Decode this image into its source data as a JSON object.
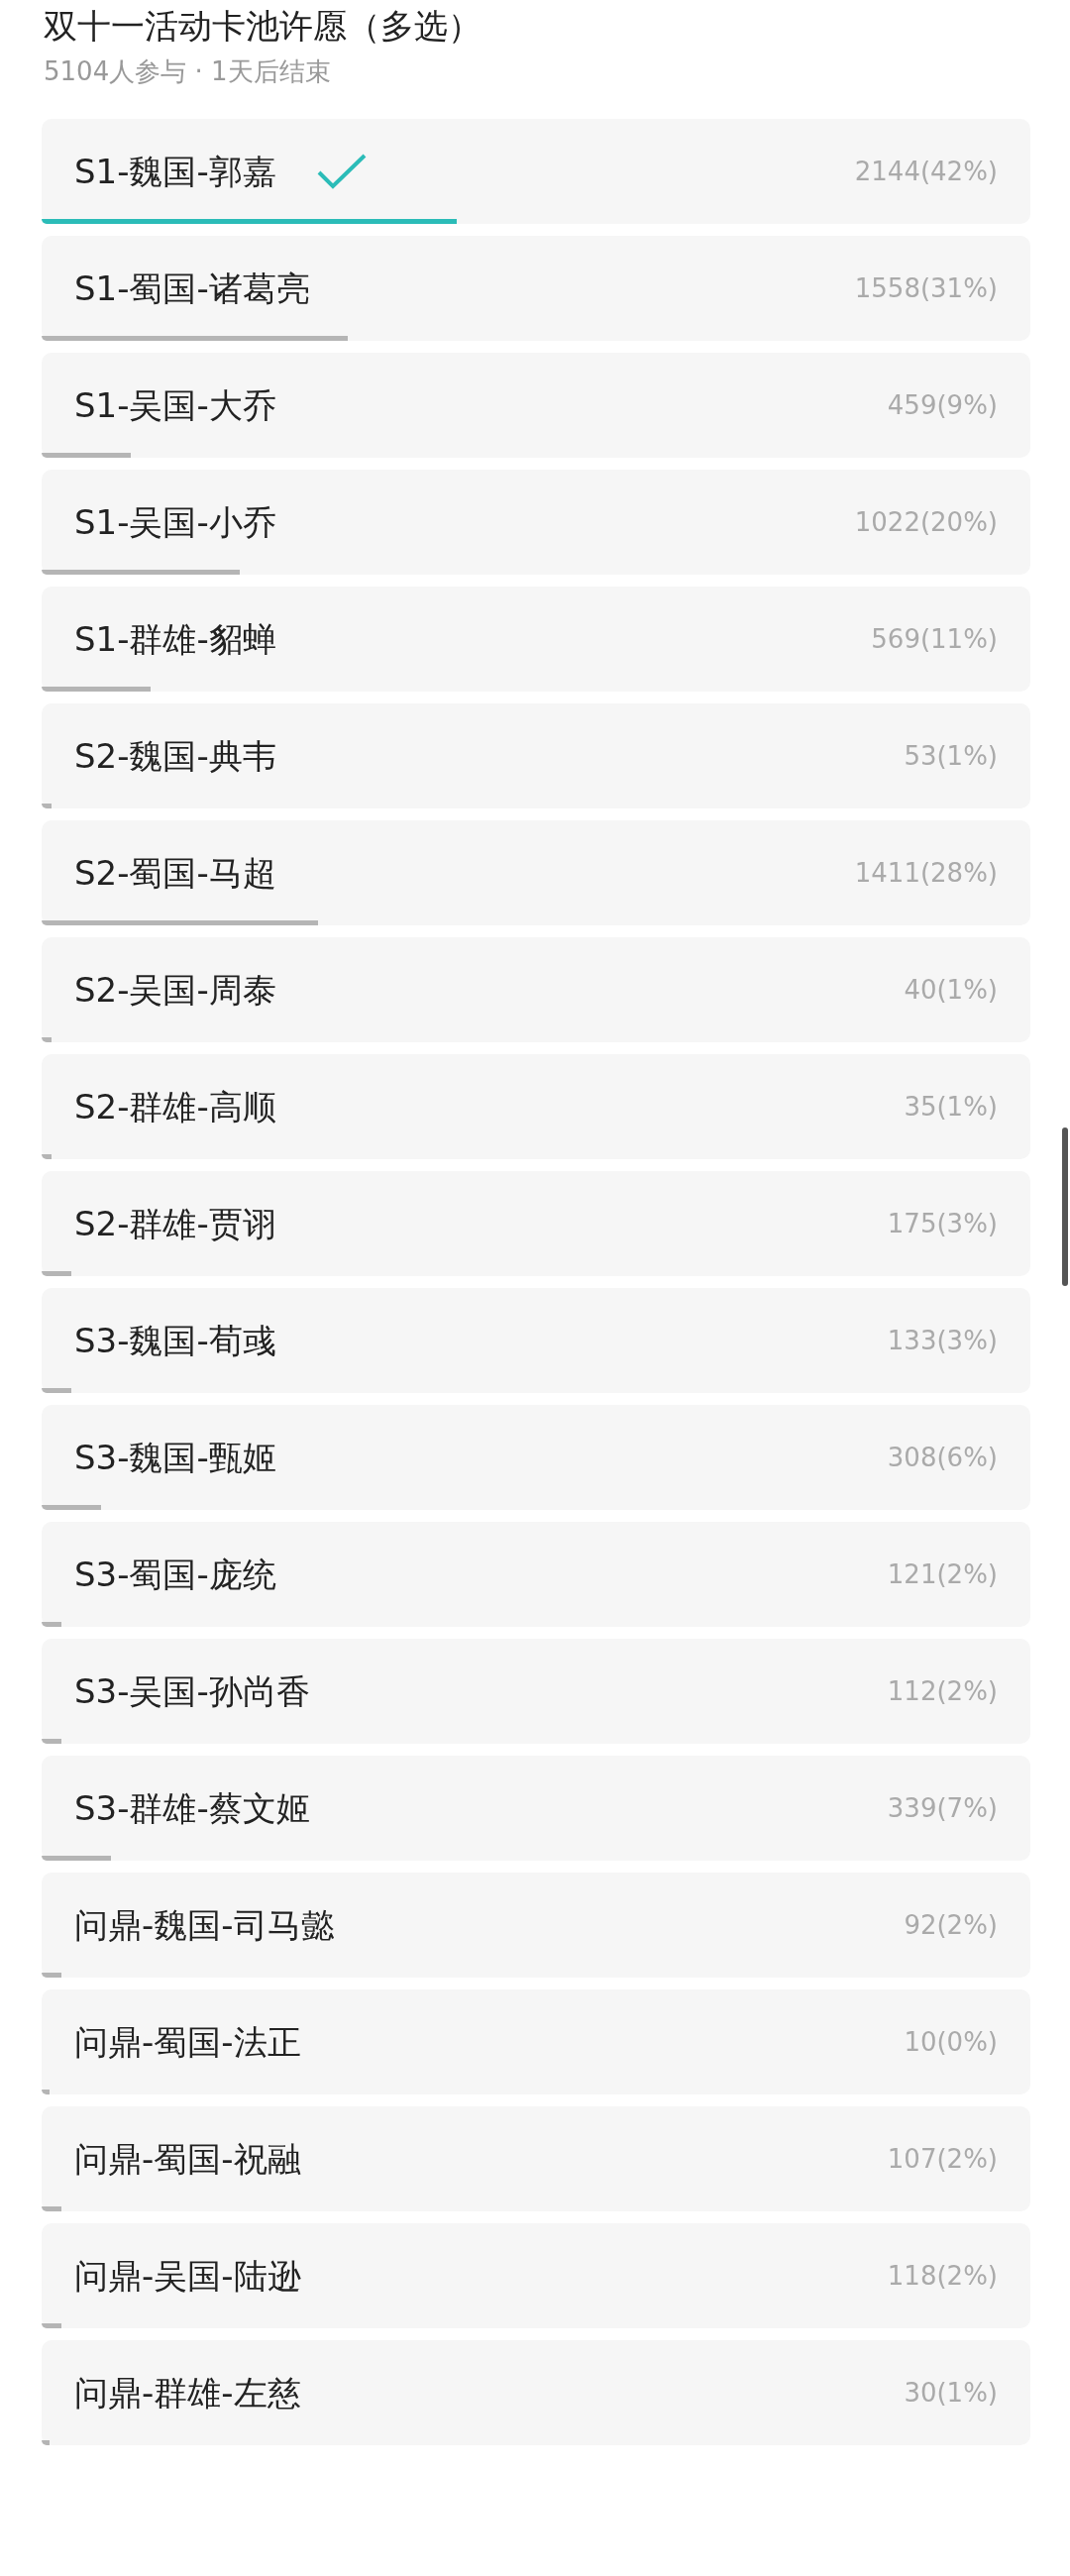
{
  "poll": {
    "title": "双十一活动卡池许愿（多选）",
    "meta": "5104人参与 · 1天后结束"
  },
  "options": [
    {
      "label": "S1-魏国-郭嘉",
      "count": "2144(42%)",
      "level": 0.42,
      "selected": true
    },
    {
      "label": "S1-蜀国-诸葛亮",
      "count": "1558(31%)",
      "level": 0.31,
      "selected": false
    },
    {
      "label": "S1-吴国-大乔",
      "count": "459(9%)",
      "level": 0.09,
      "selected": false
    },
    {
      "label": "S1-吴国-小乔",
      "count": "1022(20%)",
      "level": 0.2,
      "selected": false
    },
    {
      "label": "S1-群雄-貂蝉",
      "count": "569(11%)",
      "level": 0.11,
      "selected": false
    },
    {
      "label": "S2-魏国-典韦",
      "count": "53(1%)",
      "level": 0.01,
      "selected": false
    },
    {
      "label": "S2-蜀国-马超",
      "count": "1411(28%)",
      "level": 0.28,
      "selected": false
    },
    {
      "label": "S2-吴国-周泰",
      "count": "40(1%)",
      "level": 0.01,
      "selected": false
    },
    {
      "label": "S2-群雄-高顺",
      "count": "35(1%)",
      "level": 0.01,
      "selected": false
    },
    {
      "label": "S2-群雄-贾诩",
      "count": "175(3%)",
      "level": 0.03,
      "selected": false
    },
    {
      "label": "S3-魏国-荀彧",
      "count": "133(3%)",
      "level": 0.03,
      "selected": false
    },
    {
      "label": "S3-魏国-甄姬",
      "count": "308(6%)",
      "level": 0.06,
      "selected": false
    },
    {
      "label": "S3-蜀国-庞统",
      "count": "121(2%)",
      "level": 0.02,
      "selected": false
    },
    {
      "label": "S3-吴国-孙尚香",
      "count": "112(2%)",
      "level": 0.02,
      "selected": false
    },
    {
      "label": "S3-群雄-蔡文姬",
      "count": "339(7%)",
      "level": 0.07,
      "selected": false
    },
    {
      "label": "问鼎-魏国-司马懿",
      "count": "92(2%)",
      "level": 0.02,
      "selected": false
    },
    {
      "label": "问鼎-蜀国-法正",
      "count": "10(0%)",
      "level": 0.002,
      "selected": false
    },
    {
      "label": "问鼎-蜀国-祝融",
      "count": "107(2%)",
      "level": 0.02,
      "selected": false
    },
    {
      "label": "问鼎-吴国-陆逊",
      "count": "118(2%)",
      "level": 0.02,
      "selected": false
    },
    {
      "label": "问鼎-群雄-左慈",
      "count": "30(1%)",
      "level": 0.006,
      "selected": false
    }
  ]
}
